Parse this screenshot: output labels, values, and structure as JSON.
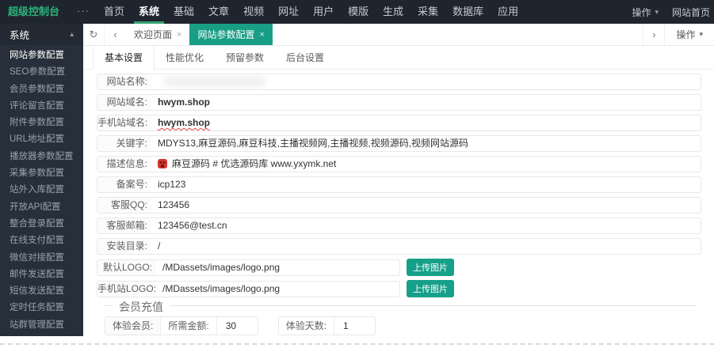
{
  "colors": {
    "topbar_bg": "#1e252f",
    "sidebar_bg": "#272f3a",
    "accent_teal": "#189e85",
    "brand_green": "#2cb37a",
    "nav_indicator_green": "#35a373"
  },
  "icons": {
    "more_menu": "···",
    "refresh": "↻",
    "chevron_left": "‹",
    "chevron_right": "›",
    "caret_down": "▾",
    "caret_up": "▴",
    "close": "×",
    "ogre_emoji": "👹"
  },
  "topbar": {
    "brand": "超级控制台",
    "nav": [
      {
        "label": "首页"
      },
      {
        "label": "系统"
      },
      {
        "label": "基础"
      },
      {
        "label": "文章"
      },
      {
        "label": "视频"
      },
      {
        "label": "网址"
      },
      {
        "label": "用户"
      },
      {
        "label": "模版"
      },
      {
        "label": "生成"
      },
      {
        "label": "采集"
      },
      {
        "label": "数据库"
      },
      {
        "label": "应用"
      }
    ],
    "operate_label": "操作",
    "home_label": "网站首页"
  },
  "sidebar": {
    "header": "系统",
    "items": [
      {
        "label": "网站参数配置"
      },
      {
        "label": "SEO参数配置"
      },
      {
        "label": "会员参数配置"
      },
      {
        "label": "评论留言配置"
      },
      {
        "label": "附件参数配置"
      },
      {
        "label": "URL地址配置"
      },
      {
        "label": "播放器参数配置"
      },
      {
        "label": "采集参数配置"
      },
      {
        "label": "站外入库配置"
      },
      {
        "label": "开放API配置"
      },
      {
        "label": "整合登录配置"
      },
      {
        "label": "在线支付配置"
      },
      {
        "label": "微信对接配置"
      },
      {
        "label": "邮件发送配置"
      },
      {
        "label": "短信发送配置"
      },
      {
        "label": "定时任务配置"
      },
      {
        "label": "站群管理配置"
      }
    ]
  },
  "tabbar": {
    "tabs": [
      {
        "label": "欢迎页面"
      },
      {
        "label": "网站参数配置"
      }
    ],
    "operate_label": "操作"
  },
  "subtabs": [
    {
      "label": "基本设置"
    },
    {
      "label": "性能优化"
    },
    {
      "label": "预留参数"
    },
    {
      "label": "后台设置"
    }
  ],
  "form": {
    "rows": [
      {
        "label": "网站名称:",
        "value": ""
      },
      {
        "label": "网站域名:",
        "value": "hwym.shop"
      },
      {
        "label": "手机站域名:",
        "value": "hwym.shop"
      },
      {
        "label": "关键字:",
        "value": "MDYS13,麻豆源码,麻豆科技,主播视频网,主播视频,视频源码,视频网站源码"
      },
      {
        "label": "描述信息:",
        "value": "麻豆源码 # 优选源码库  www.yxymk.net"
      },
      {
        "label": "备案号:",
        "value": "icp123"
      },
      {
        "label": "客服QQ:",
        "value": "123456"
      },
      {
        "label": "客服邮箱:",
        "value": "123456@test.cn"
      },
      {
        "label": "安装目录:",
        "value": "/"
      }
    ],
    "logo_rows": [
      {
        "label": "默认LOGO:",
        "value": "/MDassets/images/logo.png",
        "button_label": "上传图片"
      },
      {
        "label": "手机站LOGO:",
        "value": "/MDassets/images/logo.png",
        "button_label": "上传图片"
      }
    ],
    "member_recharge": {
      "legend": "会员充值",
      "member_label": "体验会员:",
      "amount_label": "所需金额:",
      "amount_value": "30",
      "days_label": "体验天数:",
      "days_value": "1"
    }
  }
}
